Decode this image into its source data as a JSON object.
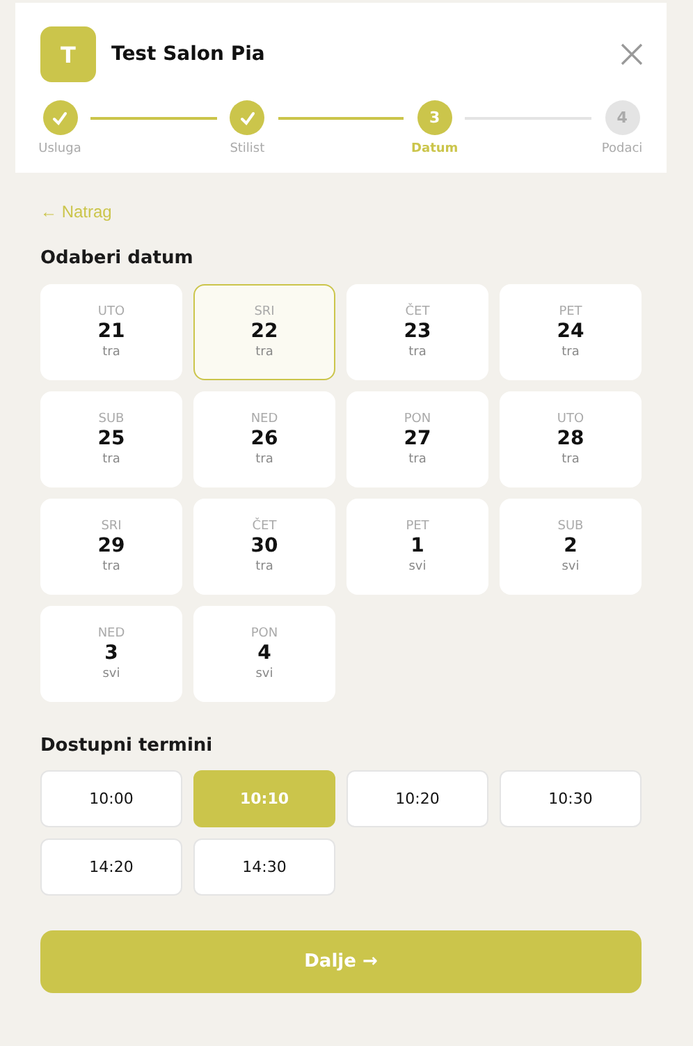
{
  "header": {
    "logo_letter": "T",
    "title": "Test Salon Pia"
  },
  "steps": [
    {
      "label": "Usluga",
      "kind": "done"
    },
    {
      "label": "Stilist",
      "kind": "done"
    },
    {
      "label": "Datum",
      "kind": "current",
      "number": "3"
    },
    {
      "label": "Podaci",
      "kind": "upcoming",
      "number": "4"
    }
  ],
  "back_link": "← Natrag",
  "date_section": {
    "title": "Odaberi datum",
    "dates": [
      {
        "weekday": "UTO",
        "day": "21",
        "month": "tra",
        "selected": false
      },
      {
        "weekday": "SRI",
        "day": "22",
        "month": "tra",
        "selected": true
      },
      {
        "weekday": "ČET",
        "day": "23",
        "month": "tra",
        "selected": false
      },
      {
        "weekday": "PET",
        "day": "24",
        "month": "tra",
        "selected": false
      },
      {
        "weekday": "SUB",
        "day": "25",
        "month": "tra",
        "selected": false
      },
      {
        "weekday": "NED",
        "day": "26",
        "month": "tra",
        "selected": false
      },
      {
        "weekday": "PON",
        "day": "27",
        "month": "tra",
        "selected": false
      },
      {
        "weekday": "UTO",
        "day": "28",
        "month": "tra",
        "selected": false
      },
      {
        "weekday": "SRI",
        "day": "29",
        "month": "tra",
        "selected": false
      },
      {
        "weekday": "ČET",
        "day": "30",
        "month": "tra",
        "selected": false
      },
      {
        "weekday": "PET",
        "day": "1",
        "month": "svi",
        "selected": false
      },
      {
        "weekday": "SUB",
        "day": "2",
        "month": "svi",
        "selected": false
      },
      {
        "weekday": "NED",
        "day": "3",
        "month": "svi",
        "selected": false
      },
      {
        "weekday": "PON",
        "day": "4",
        "month": "svi",
        "selected": false
      }
    ]
  },
  "time_section": {
    "title": "Dostupni termini",
    "slots": [
      {
        "time": "10:00",
        "selected": false
      },
      {
        "time": "10:10",
        "selected": true
      },
      {
        "time": "10:20",
        "selected": false
      },
      {
        "time": "10:30",
        "selected": false
      },
      {
        "time": "14:20",
        "selected": false
      },
      {
        "time": "14:30",
        "selected": false
      }
    ]
  },
  "next_button": "Dalje →"
}
